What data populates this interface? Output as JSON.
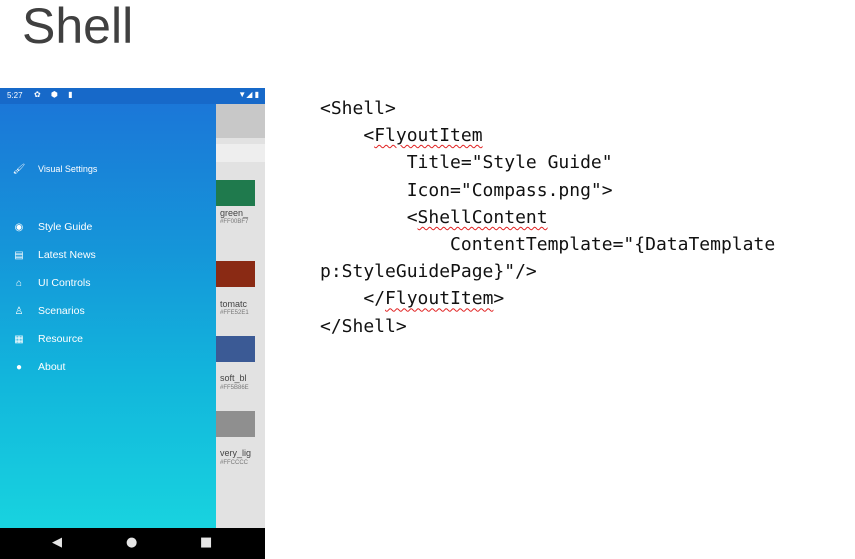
{
  "slide": {
    "title": "Shell"
  },
  "phone": {
    "status_bar": {
      "time": "5:27"
    },
    "drawer": {
      "settings_item": {
        "label": "Visual Settings",
        "icon": "brush-icon"
      },
      "items": [
        {
          "label": "Style Guide",
          "icon": "compass-icon"
        },
        {
          "label": "Latest News",
          "icon": "newspaper-icon"
        },
        {
          "label": "UI Controls",
          "icon": "controls-icon"
        },
        {
          "label": "Scenarios",
          "icon": "person-icon"
        },
        {
          "label": "Resource",
          "icon": "boxes-icon"
        },
        {
          "label": "About",
          "icon": "info-icon"
        }
      ],
      "gradient_top": "#1b77d8",
      "gradient_bottom": "#18d3df"
    },
    "background_page": {
      "swatches": [
        {
          "name": "green_",
          "hex": "#FF00BF7",
          "color": "#1f7a4d"
        },
        {
          "name": "tomatc",
          "hex": "#FFE52E1",
          "color": "#8a2a14"
        },
        {
          "name": "soft_bl",
          "hex": "#FF5B86E",
          "color": "#3b5a95"
        },
        {
          "name": "very_lig",
          "hex": "#FFCCCC",
          "color": "#8f8f8f"
        }
      ]
    },
    "nav_bar": {
      "back": "◀",
      "home": "●",
      "recents": "■"
    }
  },
  "code": {
    "lines": [
      "<Shell>",
      "    <FlyoutItem",
      "        Title=\"Style Guide\"",
      "        Icon=\"Compass.png\">",
      "        <ShellContent",
      "            ContentTemplate=\"{DataTemplate",
      "p:StyleGuidePage}\"/>",
      "    </FlyoutItem>",
      "</Shell>"
    ]
  }
}
